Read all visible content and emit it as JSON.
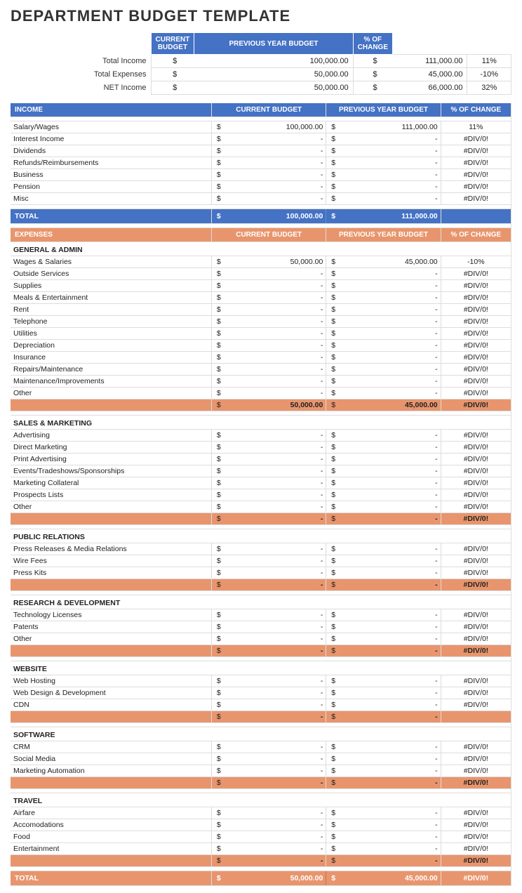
{
  "title": "DEPARTMENT BUDGET TEMPLATE",
  "summary": {
    "headers": [
      "",
      "CURRENT BUDGET",
      "PREVIOUS YEAR BUDGET",
      "% OF CHANGE"
    ],
    "rows": [
      {
        "label": "Total Income",
        "current": "100,000.00",
        "previous": "111,000.00",
        "change": "11%"
      },
      {
        "label": "Total Expenses",
        "current": "50,000.00",
        "previous": "45,000.00",
        "change": "-10%"
      },
      {
        "label": "NET Income",
        "current": "50,000.00",
        "previous": "66,000.00",
        "change": "32%"
      }
    ]
  },
  "income": {
    "section": "INCOME",
    "headers": [
      "CURRENT BUDGET",
      "PREVIOUS YEAR BUDGET",
      "% OF CHANGE"
    ],
    "items": [
      {
        "label": "Salary/Wages",
        "current": "100,000.00",
        "previous": "111,000.00",
        "change": "11%"
      },
      {
        "label": "Interest Income",
        "current": "-",
        "previous": "-",
        "change": "#DIV/0!"
      },
      {
        "label": "Dividends",
        "current": "-",
        "previous": "-",
        "change": "#DIV/0!"
      },
      {
        "label": "Refunds/Reimbursements",
        "current": "-",
        "previous": "-",
        "change": "#DIV/0!"
      },
      {
        "label": "Business",
        "current": "-",
        "previous": "-",
        "change": "#DIV/0!"
      },
      {
        "label": "Pension",
        "current": "-",
        "previous": "-",
        "change": "#DIV/0!"
      },
      {
        "label": "Misc",
        "current": "-",
        "previous": "-",
        "change": "#DIV/0!"
      }
    ],
    "total": {
      "current": "100,000.00",
      "previous": "111,000.00"
    }
  },
  "expenses": {
    "section": "EXPENSES",
    "headers": [
      "CURRENT BUDGET",
      "PREVIOUS YEAR BUDGET",
      "% OF CHANGE"
    ],
    "sections": [
      {
        "name": "GENERAL & ADMIN",
        "items": [
          {
            "label": "Wages & Salaries",
            "current": "50,000.00",
            "previous": "45,000.00",
            "change": "-10%"
          },
          {
            "label": "Outside Services",
            "current": "-",
            "previous": "-",
            "change": "#DIV/0!"
          },
          {
            "label": "Supplies",
            "current": "-",
            "previous": "-",
            "change": "#DIV/0!"
          },
          {
            "label": "Meals & Entertainment",
            "current": "-",
            "previous": "-",
            "change": "#DIV/0!"
          },
          {
            "label": "Rent",
            "current": "-",
            "previous": "-",
            "change": "#DIV/0!"
          },
          {
            "label": "Telephone",
            "current": "-",
            "previous": "-",
            "change": "#DIV/0!"
          },
          {
            "label": "Utilities",
            "current": "-",
            "previous": "-",
            "change": "#DIV/0!"
          },
          {
            "label": "Depreciation",
            "current": "-",
            "previous": "-",
            "change": "#DIV/0!"
          },
          {
            "label": "Insurance",
            "current": "-",
            "previous": "-",
            "change": "#DIV/0!"
          },
          {
            "label": "Repairs/Maintenance",
            "current": "-",
            "previous": "-",
            "change": "#DIV/0!"
          },
          {
            "label": "Maintenance/Improvements",
            "current": "-",
            "previous": "-",
            "change": "#DIV/0!"
          },
          {
            "label": "Other",
            "current": "-",
            "previous": "-",
            "change": "#DIV/0!"
          }
        ],
        "subtotal": {
          "current": "50,000.00",
          "previous": "45,000.00",
          "change": "#DIV/0!"
        }
      },
      {
        "name": "SALES & MARKETING",
        "items": [
          {
            "label": "Advertising",
            "current": "-",
            "previous": "-",
            "change": "#DIV/0!"
          },
          {
            "label": "Direct Marketing",
            "current": "-",
            "previous": "-",
            "change": "#DIV/0!"
          },
          {
            "label": "Print Advertising",
            "current": "-",
            "previous": "-",
            "change": "#DIV/0!"
          },
          {
            "label": "Events/Tradeshows/Sponsorships",
            "current": "-",
            "previous": "-",
            "change": "#DIV/0!"
          },
          {
            "label": "Marketing Collateral",
            "current": "-",
            "previous": "-",
            "change": "#DIV/0!"
          },
          {
            "label": "Prospects Lists",
            "current": "-",
            "previous": "-",
            "change": "#DIV/0!"
          },
          {
            "label": "Other",
            "current": "-",
            "previous": "-",
            "change": "#DIV/0!"
          }
        ],
        "subtotal": {
          "current": "-",
          "previous": "-",
          "change": "#DIV/0!"
        }
      },
      {
        "name": "PUBLIC RELATIONS",
        "items": [
          {
            "label": "Press Releases & Media Relations",
            "current": "-",
            "previous": "-",
            "change": "#DIV/0!"
          },
          {
            "label": "Wire Fees",
            "current": "-",
            "previous": "-",
            "change": "#DIV/0!"
          },
          {
            "label": "Press Kits",
            "current": "-",
            "previous": "-",
            "change": "#DIV/0!"
          }
        ],
        "subtotal": {
          "current": "-",
          "previous": "-",
          "change": "#DIV/0!"
        }
      },
      {
        "name": "RESEARCH & DEVELOPMENT",
        "items": [
          {
            "label": "Technology Licenses",
            "current": "-",
            "previous": "-",
            "change": "#DIV/0!"
          },
          {
            "label": "Patents",
            "current": "-",
            "previous": "-",
            "change": "#DIV/0!"
          },
          {
            "label": "Other",
            "current": "-",
            "previous": "-",
            "change": "#DIV/0!"
          }
        ],
        "subtotal": {
          "current": "-",
          "previous": "-",
          "change": "#DIV/0!"
        }
      },
      {
        "name": "WEBSITE",
        "items": [
          {
            "label": "Web Hosting",
            "current": "-",
            "previous": "-",
            "change": "#DIV/0!"
          },
          {
            "label": "Web Design & Development",
            "current": "-",
            "previous": "-",
            "change": "#DIV/0!"
          },
          {
            "label": "CDN",
            "current": "-",
            "previous": "-",
            "change": "#DIV/0!"
          }
        ],
        "subtotal": {
          "current": "-",
          "previous": "-",
          "change": ""
        }
      },
      {
        "name": "SOFTWARE",
        "items": [
          {
            "label": "CRM",
            "current": "-",
            "previous": "-",
            "change": "#DIV/0!"
          },
          {
            "label": "Social Media",
            "current": "-",
            "previous": "-",
            "change": "#DIV/0!"
          },
          {
            "label": "Marketing Automation",
            "current": "-",
            "previous": "-",
            "change": "#DIV/0!"
          }
        ],
        "subtotal": {
          "current": "-",
          "previous": "-",
          "change": "#DIV/0!"
        }
      },
      {
        "name": "TRAVEL",
        "items": [
          {
            "label": "Airfare",
            "current": "-",
            "previous": "-",
            "change": "#DIV/0!"
          },
          {
            "label": "Accomodations",
            "current": "-",
            "previous": "-",
            "change": "#DIV/0!"
          },
          {
            "label": "Food",
            "current": "-",
            "previous": "-",
            "change": "#DIV/0!"
          },
          {
            "label": "Entertainment",
            "current": "-",
            "previous": "-",
            "change": "#DIV/0!"
          }
        ],
        "subtotal": {
          "current": "-",
          "previous": "-",
          "change": "#DIV/0!"
        }
      }
    ],
    "total": {
      "current": "50,000.00",
      "previous": "45,000.00",
      "change": "#DIV/0!"
    }
  },
  "labels": {
    "total": "TOTAL",
    "dollar": "$"
  }
}
